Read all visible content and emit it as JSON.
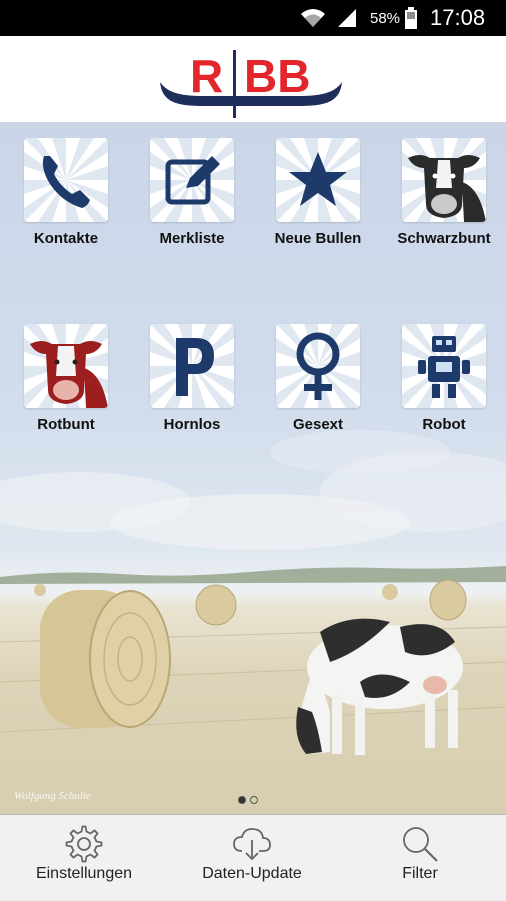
{
  "status_bar": {
    "battery_percent": "58%",
    "time": "17:08"
  },
  "logo": {
    "text": "RBB",
    "color_red": "#e3262b",
    "color_navy": "#1e2d5a"
  },
  "tiles": [
    {
      "label": "Kontakte",
      "icon": "phone-icon"
    },
    {
      "label": "Merkliste",
      "icon": "edit-icon"
    },
    {
      "label": "Neue Bullen",
      "icon": "star-icon"
    },
    {
      "label": "Schwarzbunt",
      "icon": "black-cow-icon"
    },
    {
      "label": "Rotbunt",
      "icon": "red-cow-icon"
    },
    {
      "label": "Hornlos",
      "icon": "letter-p-icon"
    },
    {
      "label": "Gesext",
      "icon": "female-symbol-icon"
    },
    {
      "label": "Robot",
      "icon": "robot-icon"
    }
  ],
  "background": {
    "watermark": "Wolfgang Schulte"
  },
  "pager": {
    "pages": 2,
    "current": 1
  },
  "bottom_bar": [
    {
      "label": "Einstellungen",
      "icon": "gear-icon"
    },
    {
      "label": "Daten-Update",
      "icon": "cloud-download-icon"
    },
    {
      "label": "Filter",
      "icon": "search-icon"
    }
  ],
  "colors": {
    "icon_navy": "#1d3a6a",
    "header_bg": "#ffffff",
    "bottom_bar_bg": "#f1f1f1"
  }
}
